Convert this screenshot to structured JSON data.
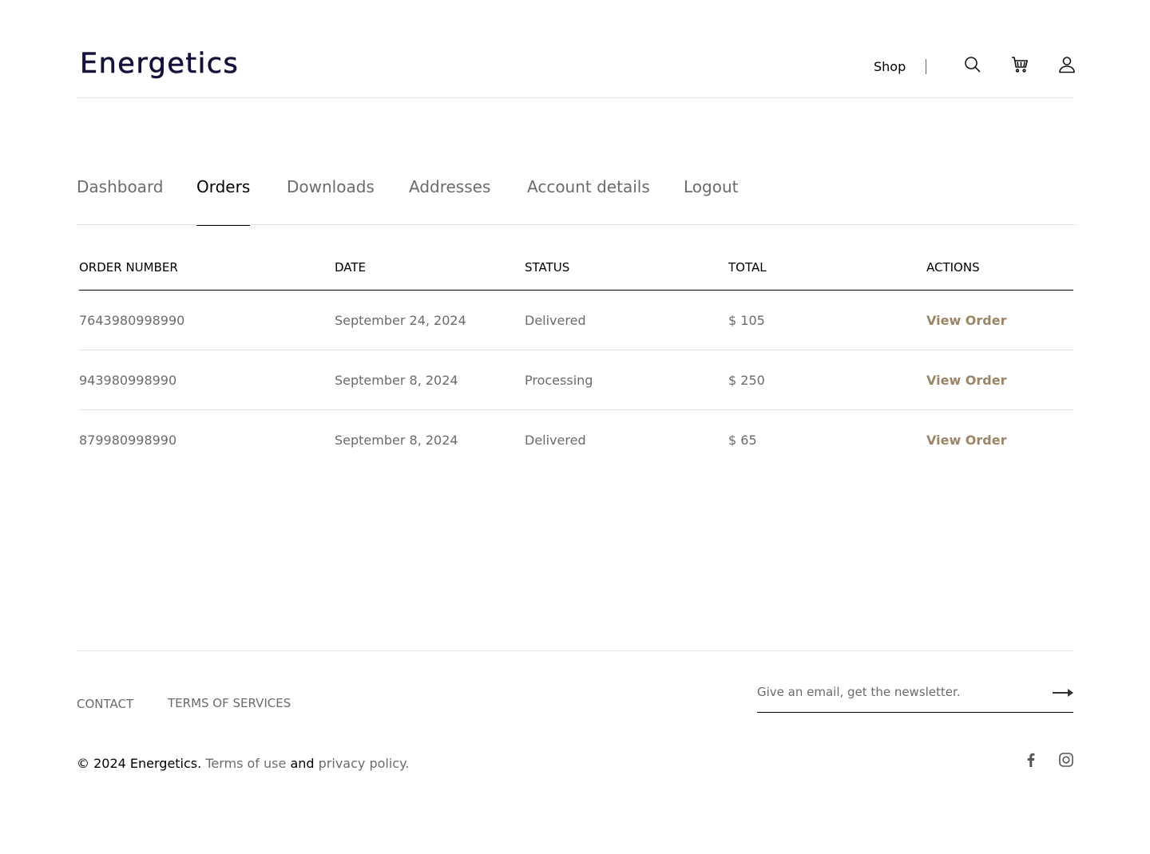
{
  "header": {
    "logo": "Energetics",
    "nav_shop": "Shop",
    "icons": [
      "search-icon",
      "cart-icon",
      "user-icon"
    ]
  },
  "tabs": [
    {
      "label": "Dashboard",
      "active": false
    },
    {
      "label": "Orders",
      "active": true
    },
    {
      "label": "Downloads",
      "active": false
    },
    {
      "label": "Addresses",
      "active": false
    },
    {
      "label": "Account details",
      "active": false
    },
    {
      "label": "Logout",
      "active": false
    }
  ],
  "orders": {
    "columns": [
      "ORDER NUMBER",
      "DATE",
      "STATUS",
      "TOTAL",
      "ACTIONS"
    ],
    "rows": [
      {
        "number": "7643980998990",
        "date": "September 24, 2024",
        "status": "Delivered",
        "total": "$ 105",
        "action": "View Order"
      },
      {
        "number": "943980998990",
        "date": "September 8, 2024",
        "status": "Processing",
        "total": "$ 250",
        "action": "View Order"
      },
      {
        "number": "879980998990",
        "date": "September 8, 2024",
        "status": "Delivered",
        "total": "$ 65",
        "action": "View Order"
      }
    ]
  },
  "footer": {
    "contact": "CONTACT",
    "terms_services": "TERMS OF SERVICES",
    "newsletter_placeholder": "Give an email, get the newsletter.",
    "copyright_prefix": "© 2024 Energetics.",
    "terms_of_use": "Terms of use",
    "and": "and",
    "privacy_policy": "privacy policy.",
    "social": [
      "facebook-icon",
      "instagram-icon"
    ]
  },
  "colors": {
    "logo": "#15123a",
    "muted_text": "#6b6b6b",
    "action_link": "#9c8566",
    "divider": "#e3e3e3"
  }
}
